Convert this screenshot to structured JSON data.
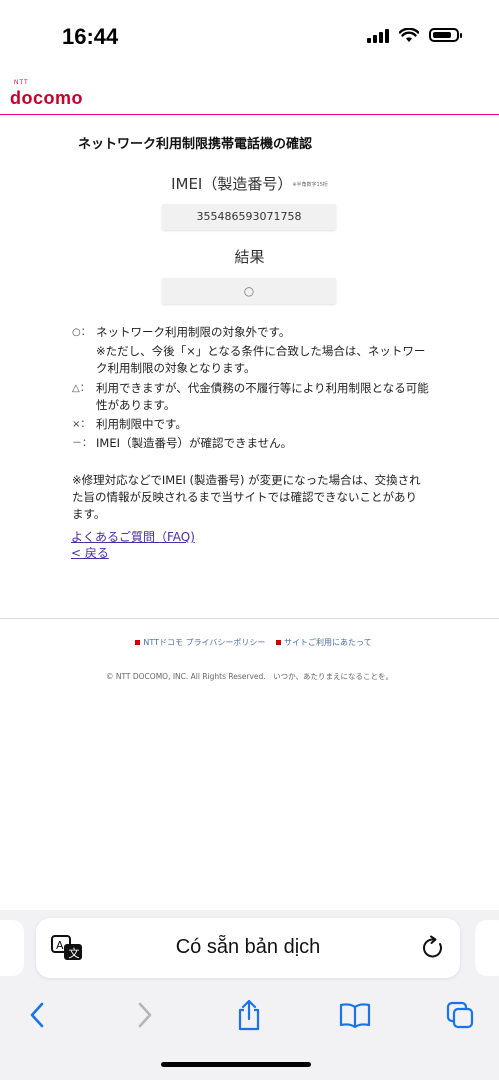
{
  "status_bar": {
    "time": "16:44",
    "battery_level": 0.8
  },
  "header": {
    "logo_small": "NTT",
    "logo_main": "docomo",
    "brand_color": "#c6002b",
    "rule_color": "#e6007e"
  },
  "main": {
    "title": "ネットワーク利用制限携帯電話機の確認",
    "imei_label": "IMEI（製造番号）",
    "imei_note": "※半角数字15桁",
    "imei_value": "355486593071758",
    "result_label": "結果",
    "result_value": "○"
  },
  "legend": [
    {
      "symbol": "○：",
      "text": "ネットワーク利用制限の対象外です。"
    },
    {
      "symbol": "",
      "text": "※ただし、今後「×」となる条件に合致した場合は、ネットワーク利用制限の対象となります。"
    },
    {
      "symbol": "△：",
      "text": "利用できますが、代金債務の不履行等により利用制限となる可能性があります。"
    },
    {
      "symbol": "×：",
      "text": "利用制限中です。"
    },
    {
      "symbol": "－：",
      "text": "IMEI（製造番号）が確認できません。"
    }
  ],
  "repair_note": "※修理対応などでIMEI (製造番号) が変更になった場合は、交換された旨の情報が反映されるまで当サイトでは確認できないことがあります。",
  "links": {
    "faq": "よくあるご質問（FAQ)",
    "back": "< 戻る"
  },
  "footer": {
    "link1": "NTTドコモ プライバシーポリシー",
    "link2": "サイトご利用にあたって",
    "copyright": "© NTT DOCOMO, INC. All Rights Reserved.　いつか、あたりまえになることを。"
  },
  "translate_bar": {
    "text": "Có sẵn bản dịch",
    "translate_icon": "translate-icon",
    "reload_icon": "reload-icon"
  },
  "toolbar": {
    "icons": [
      "back-icon",
      "forward-icon",
      "share-icon",
      "bookmarks-icon",
      "tabs-icon"
    ]
  }
}
